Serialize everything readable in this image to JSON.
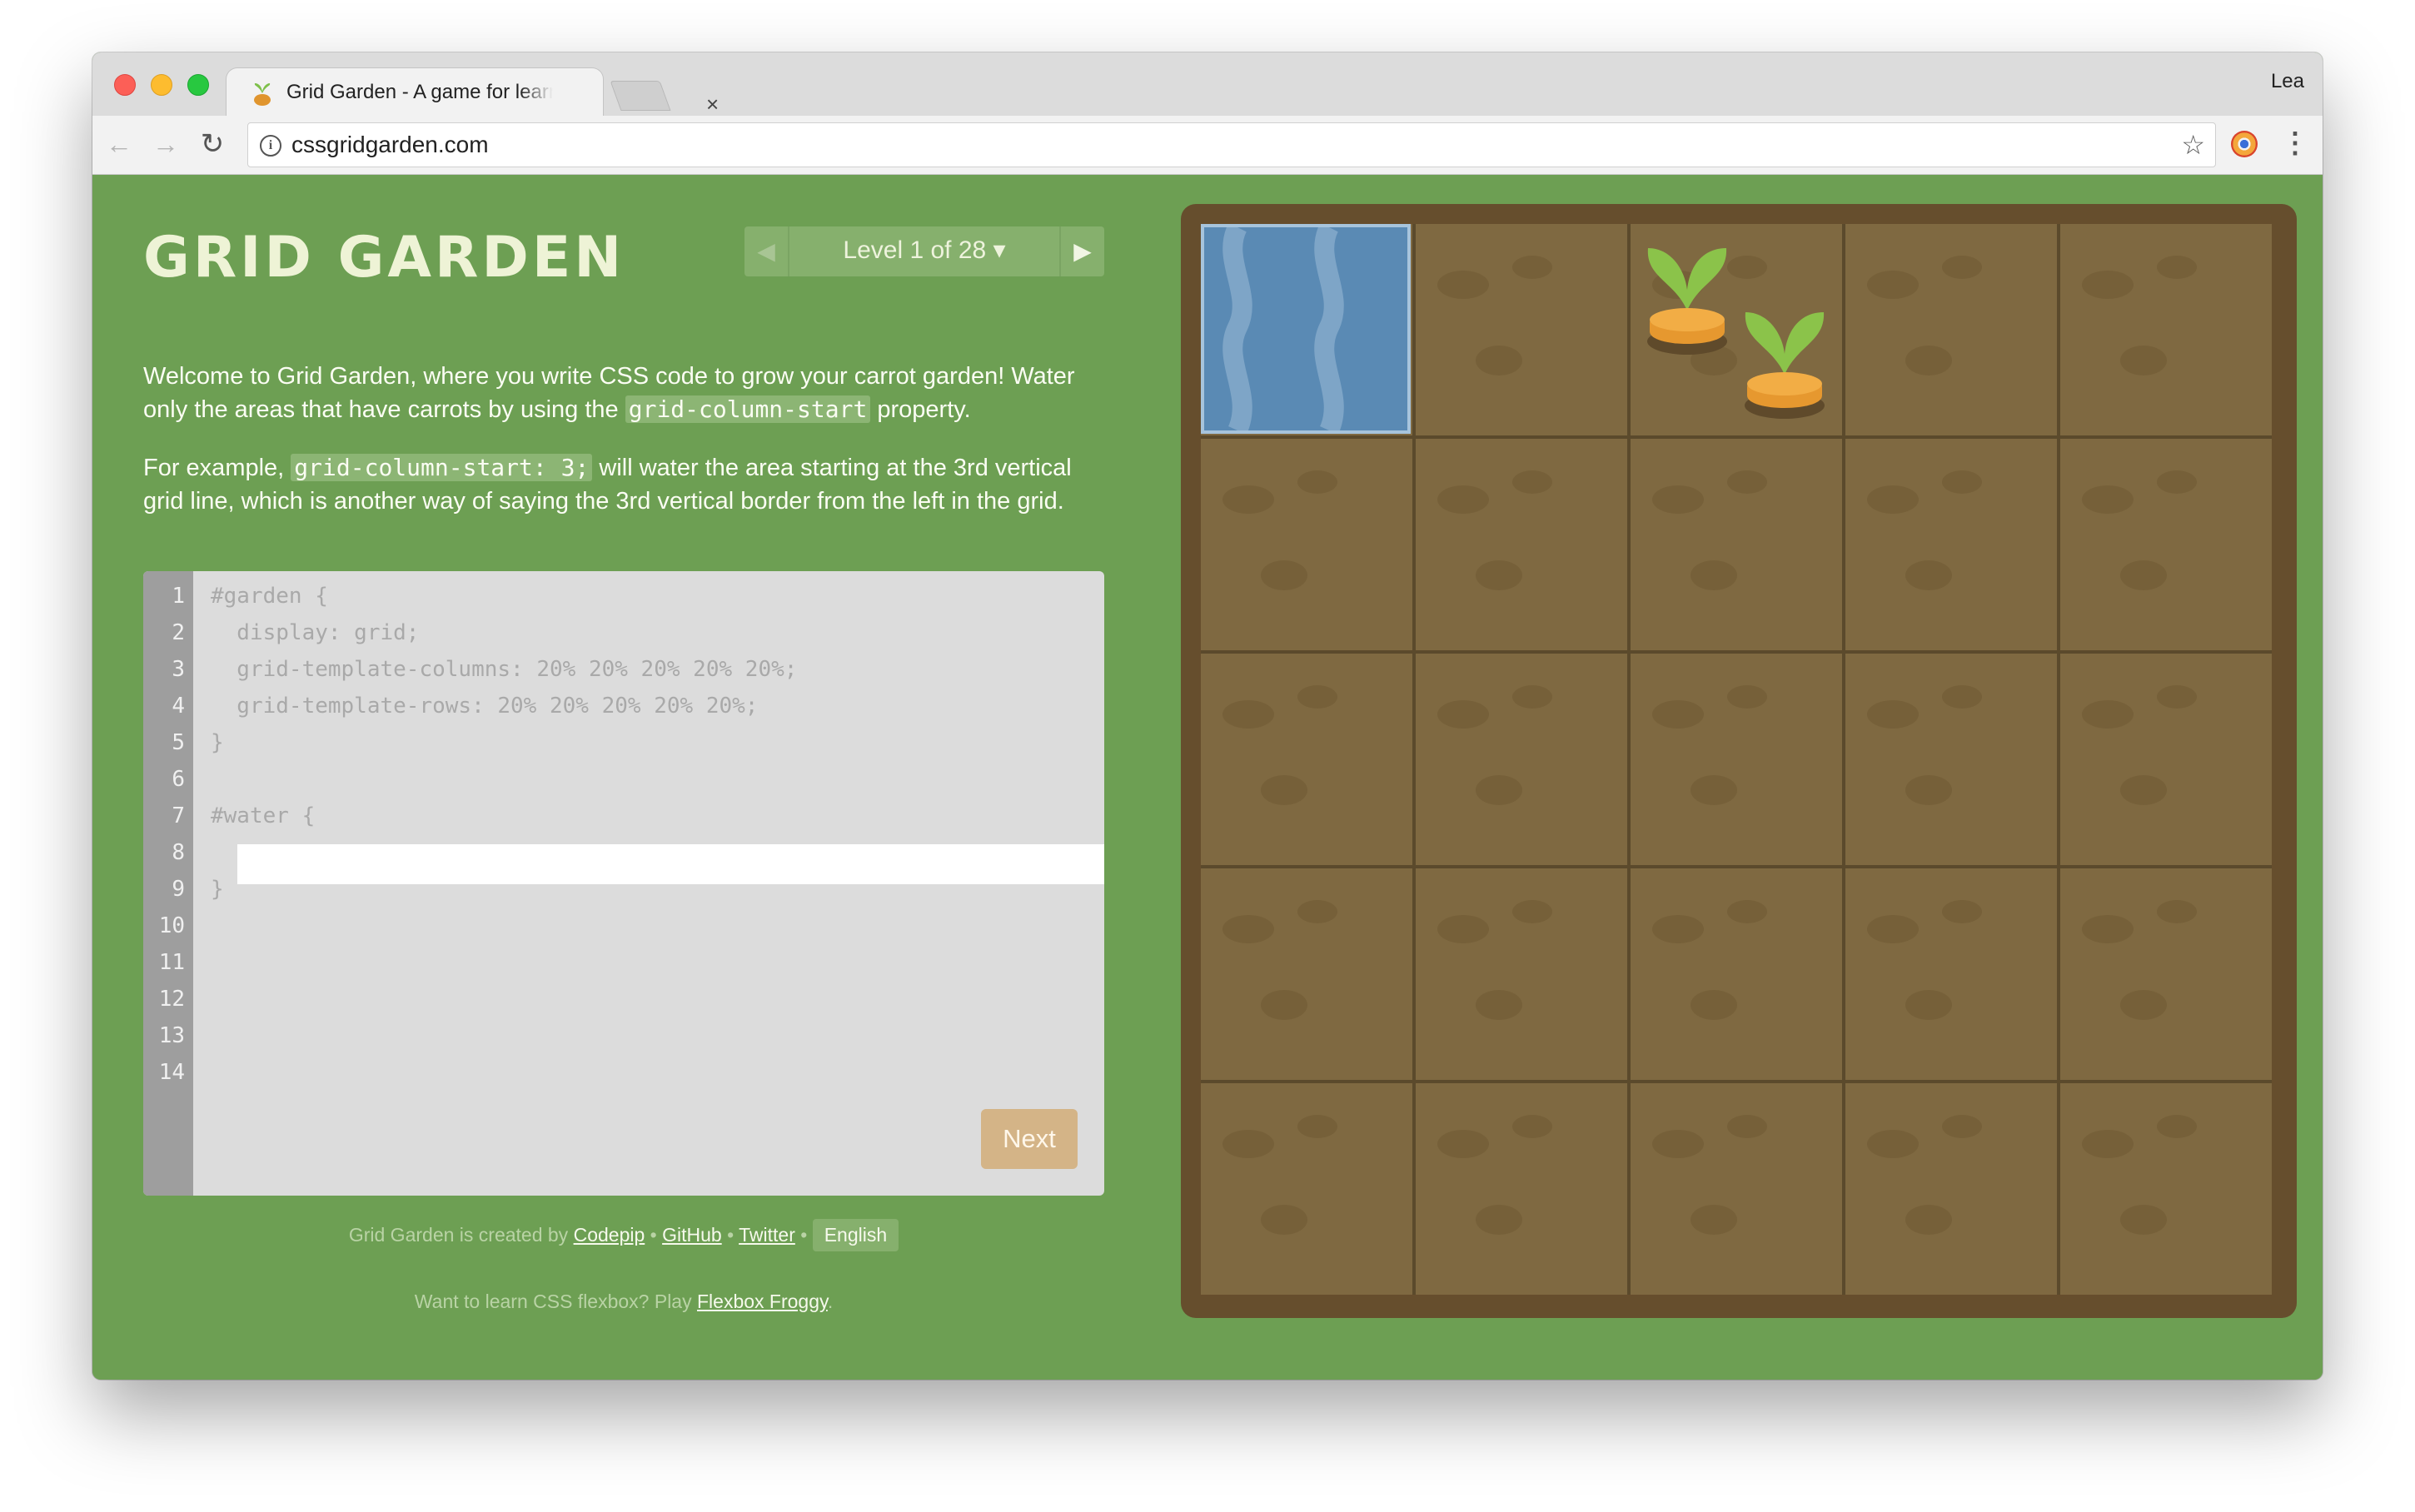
{
  "browser": {
    "tab_title": "Grid Garden - A game for learning CSS grid",
    "tab_close": "×",
    "profile_name": "Lea",
    "url": "cssgridgarden.com",
    "back_icon": "←",
    "forward_icon": "→",
    "reload_icon": "↻",
    "star_icon": "☆",
    "menu_icon": "⋮",
    "info_icon": "i"
  },
  "game": {
    "title": "GRID GARDEN",
    "level_label": "Level 1 of 28 ▾",
    "prev_icon": "◀",
    "next_icon": "▶",
    "intro": {
      "p1_before": "Welcome to Grid Garden, where you write CSS code to grow your carrot garden! Water only the areas that have carrots by using the ",
      "p1_code": "grid-column-start",
      "p1_after": " property.",
      "p2_before": "For example, ",
      "p2_code": "grid-column-start: 3;",
      "p2_after": " will water the area starting at the 3rd vertical grid line, which is another way of saying the 3rd vertical border from the left in the grid."
    },
    "editor": {
      "line_numbers": [
        "1",
        "2",
        "3",
        "4",
        "5",
        "6",
        "7",
        "8",
        "9",
        "10",
        "11",
        "12",
        "13",
        "14"
      ],
      "code_lines": [
        "#garden {",
        "  display: grid;",
        "  grid-template-columns: 20% 20% 20% 20% 20%;",
        "  grid-template-rows: 20% 20% 20% 20% 20%;",
        "}",
        "",
        "#water {",
        "",
        "}"
      ],
      "answer_value": "",
      "next_label": "Next"
    },
    "footer": {
      "created_by": "Grid Garden is created by ",
      "codepip": "Codepip",
      "sep": " • ",
      "github": "GitHub",
      "twitter": "Twitter",
      "language": "English",
      "flexbox_text": "Want to learn CSS flexbox? Play ",
      "flexbox_link": "Flexbox Froggy",
      "flexbox_end": "."
    }
  },
  "garden": {
    "rows": 5,
    "columns": 5,
    "water_cell": {
      "row": 1,
      "column": 1
    },
    "carrot_cells": [
      {
        "row": 1,
        "column": 3
      },
      {
        "row": 1,
        "column": 3
      }
    ]
  },
  "colors": {
    "page_bg": "#6d9f53",
    "soil": "#7f6941",
    "water": "#5a8ab4",
    "next_button": "#d4b487"
  }
}
